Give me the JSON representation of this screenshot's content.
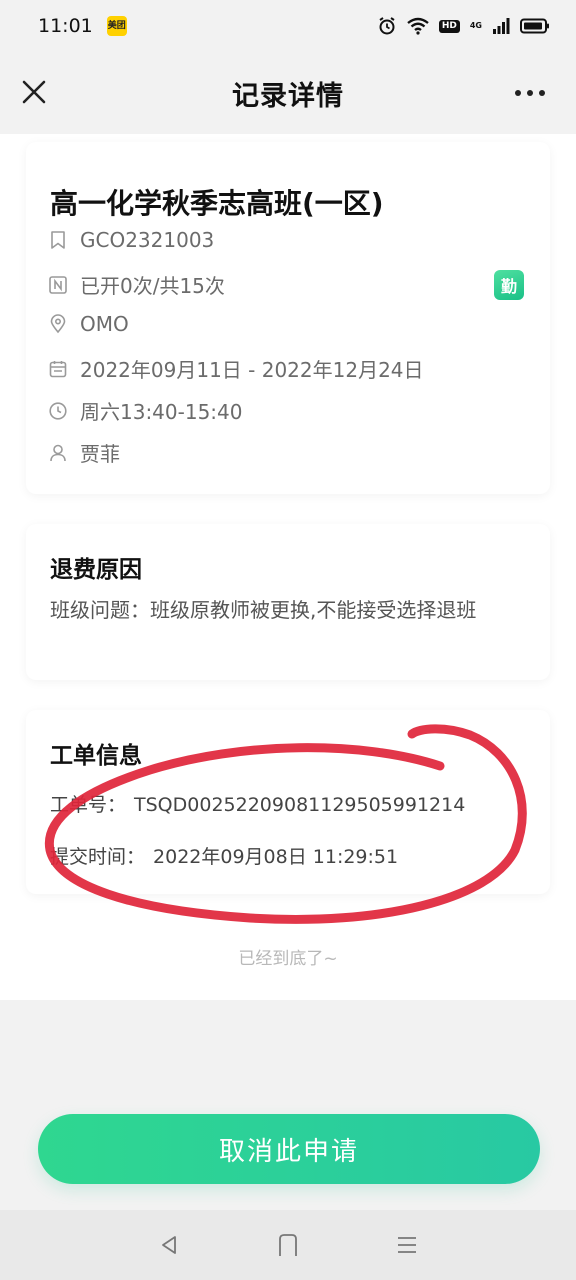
{
  "status_bar": {
    "time": "11:01",
    "app_badge_text": "美团",
    "hd_label": "HD",
    "network_label": "4G",
    "icons": [
      "alarm-icon",
      "wifi-icon",
      "signal-icon",
      "battery-icon"
    ]
  },
  "nav": {
    "title": "记录详情",
    "close_icon": "close-icon",
    "more_icon": "more-icon"
  },
  "course": {
    "title": "高一化学秋季志高班(一区)",
    "code": "GCO2321003",
    "sessions": "已开0次/共15次",
    "mode": "OMO",
    "date_range": "2022年09月11日 - 2022年12月24日",
    "schedule": "周六13:40-15:40",
    "teacher": "贾菲",
    "badge": "勤"
  },
  "refund": {
    "title": "退费原因",
    "reason": "班级问题：班级原教师被更换,不能接受选择退班"
  },
  "ticket": {
    "title": "工单信息",
    "number_label": "工单号：",
    "number_value": "TSQD0025220908112950599121​4",
    "time_label": "提交时间：",
    "time_value": "2022年09月08日 11:29:51"
  },
  "footer": {
    "end_note": "已经到底了~"
  },
  "actions": {
    "cancel_label": "取消此申请"
  },
  "colors": {
    "accent": "#2fd790",
    "annotation_red": "#e0253a"
  }
}
